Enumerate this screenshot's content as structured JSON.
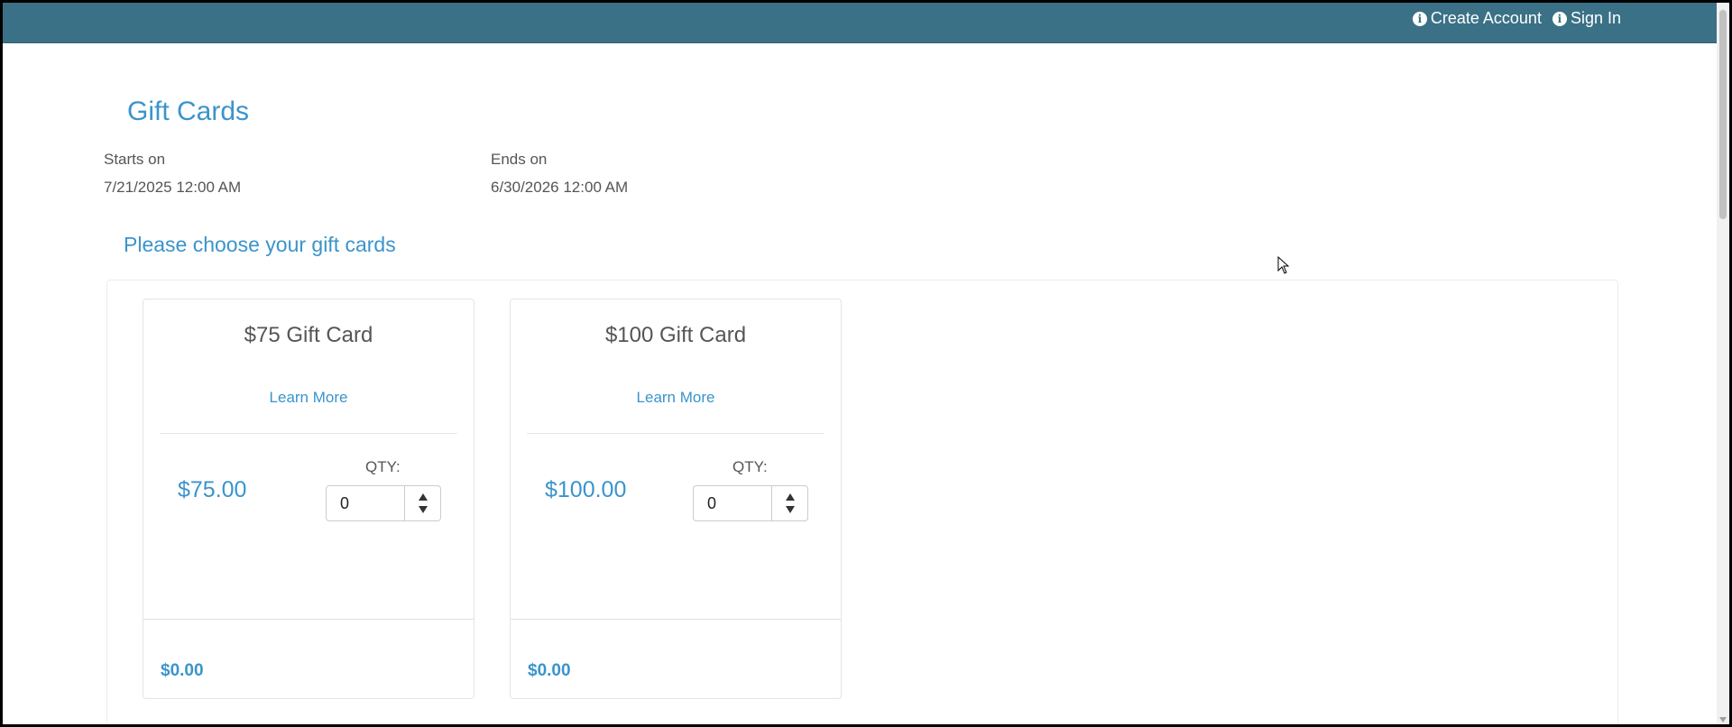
{
  "header": {
    "create_account_label": "Create Account",
    "sign_in_label": "Sign In",
    "icon": "info-circle-icon"
  },
  "page": {
    "title": "Gift Cards",
    "starts_label": "Starts on",
    "starts_value": "7/21/2025 12:00 AM",
    "ends_label": "Ends on",
    "ends_value": "6/30/2026 12:00 AM",
    "choose_heading": "Please choose your gift cards"
  },
  "cards": [
    {
      "title": "$75 Gift Card",
      "learn_more": "Learn More",
      "price": "$75.00",
      "qty_label": "QTY:",
      "qty_value": "0",
      "total": "$0.00"
    },
    {
      "title": "$100 Gift Card",
      "learn_more": "Learn More",
      "price": "$100.00",
      "qty_label": "QTY:",
      "qty_value": "0",
      "total": "$0.00"
    }
  ],
  "colors": {
    "header_bg": "#3b7186",
    "accent": "#3a94cc",
    "text": "#555555"
  }
}
